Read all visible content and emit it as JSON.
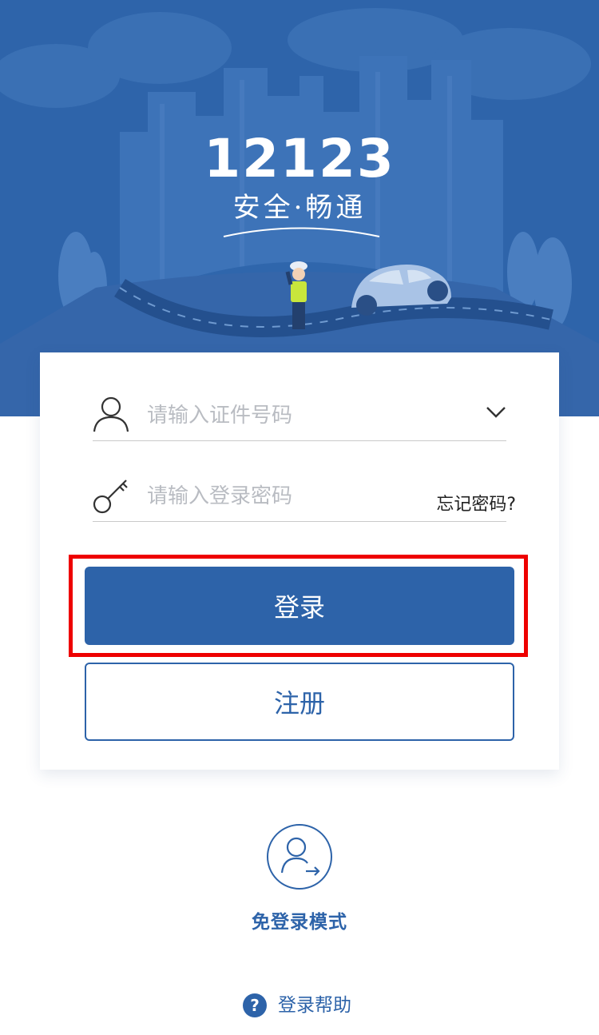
{
  "header": {
    "logo_number": "12123",
    "slogan": "安全·畅通"
  },
  "login_form": {
    "id_placeholder": "请输入证件号码",
    "password_placeholder": "请输入登录密码",
    "forgot_password": "忘记密码?",
    "login_button": "登录",
    "register_button": "注册"
  },
  "guest_mode": {
    "label": "免登录模式"
  },
  "help": {
    "icon_glyph": "?",
    "label": "登录帮助"
  },
  "colors": {
    "brand_blue": "#2d63a9",
    "hero_blue": "#2e64aa",
    "highlight_red": "#ee0000"
  }
}
